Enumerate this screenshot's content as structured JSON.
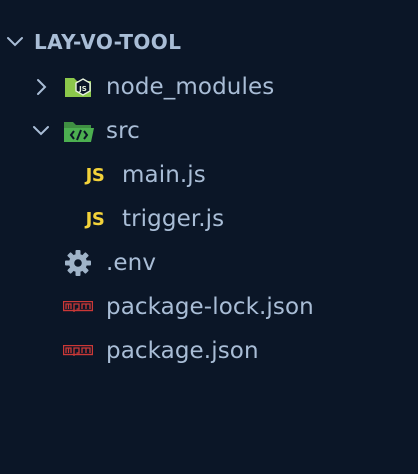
{
  "explorer": {
    "root": {
      "label": "LAY-VO-TOOL",
      "expanded": true
    },
    "items": [
      {
        "label": "node_modules",
        "type": "folder",
        "expanded": false,
        "icon": "nodejs-folder-icon"
      },
      {
        "label": "src",
        "type": "folder",
        "expanded": true,
        "icon": "src-folder-icon"
      },
      {
        "label": "main.js",
        "type": "file",
        "icon": "js-file-icon",
        "badge": "JS"
      },
      {
        "label": "trigger.js",
        "type": "file",
        "icon": "js-file-icon",
        "badge": "JS"
      },
      {
        "label": ".env",
        "type": "file",
        "icon": "gear-icon"
      },
      {
        "label": "package-lock.json",
        "type": "file",
        "icon": "npm-icon"
      },
      {
        "label": "package.json",
        "type": "file",
        "icon": "npm-icon"
      }
    ]
  },
  "colors": {
    "background": "#0b1627",
    "text": "#a9bdd6",
    "js_badge": "#f3d23a",
    "node_folder": "#8cc84b",
    "src_folder": "#4caf50",
    "npm": "#cb3837",
    "gear": "#9fb3c8"
  }
}
